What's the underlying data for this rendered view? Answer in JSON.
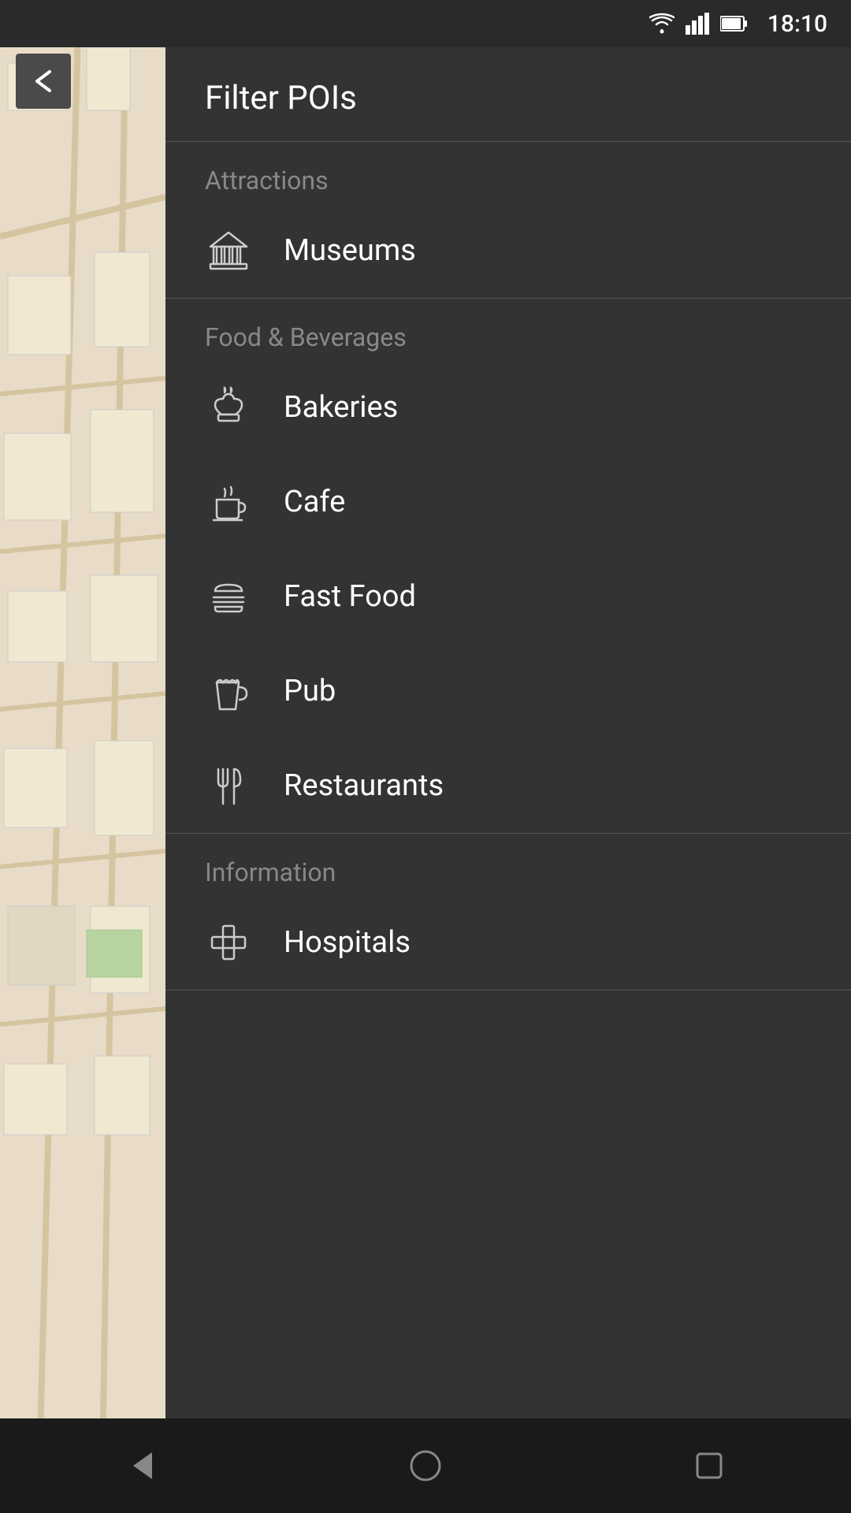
{
  "statusBar": {
    "time": "18:10"
  },
  "header": {
    "title": "Filter POIs"
  },
  "backButton": {
    "label": "←"
  },
  "sections": [
    {
      "id": "attractions",
      "label": "Attractions",
      "items": [
        {
          "id": "museums",
          "label": "Museums",
          "icon": "museum"
        }
      ]
    },
    {
      "id": "food-beverages",
      "label": "Food & Beverages",
      "items": [
        {
          "id": "bakeries",
          "label": "Bakeries",
          "icon": "bakery"
        },
        {
          "id": "cafe",
          "label": "Cafe",
          "icon": "cafe"
        },
        {
          "id": "fast-food",
          "label": "Fast Food",
          "icon": "fastfood"
        },
        {
          "id": "pub",
          "label": "Pub",
          "icon": "pub"
        },
        {
          "id": "restaurants",
          "label": "Restaurants",
          "icon": "restaurant"
        }
      ]
    },
    {
      "id": "information",
      "label": "Information",
      "items": [
        {
          "id": "hospitals",
          "label": "Hospitals",
          "icon": "hospital"
        }
      ]
    }
  ],
  "navBar": {
    "back": "back",
    "home": "home",
    "recent": "recent"
  }
}
